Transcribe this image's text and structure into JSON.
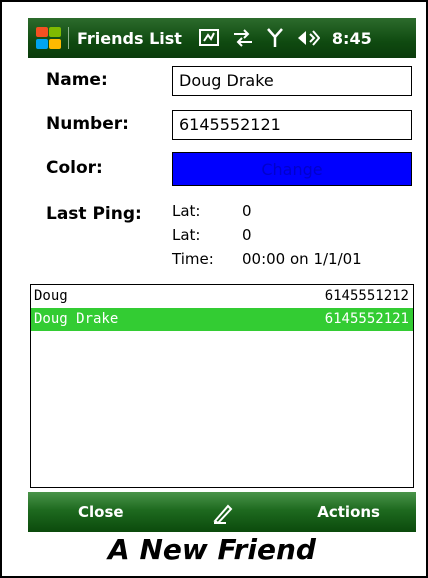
{
  "titlebar": {
    "title": "Friends List",
    "clock": "8:45",
    "icons": [
      "windows-start-icon",
      "sync-icon",
      "data-arrows-icon",
      "signal-icon",
      "volume-icon"
    ]
  },
  "form": {
    "name_label": "Name:",
    "name_value": "Doug Drake",
    "number_label": "Number:",
    "number_value": "6145552121",
    "color_label": "Color:",
    "color_button_label": "Change",
    "color_value": "#0000ff",
    "last_ping_label": "Last Ping:",
    "ping": [
      {
        "key": "Lat:",
        "value": "0"
      },
      {
        "key": "Lat:",
        "value": "0"
      },
      {
        "key": "Time:",
        "value": "00:00 on 1/1/01"
      }
    ]
  },
  "friends": [
    {
      "name": "Doug",
      "number": "6145551212",
      "selected": false
    },
    {
      "name": "Doug Drake",
      "number": "6145552121",
      "selected": true
    }
  ],
  "softkeys": {
    "left": "Close",
    "right": "Actions"
  },
  "caption": "A New Friend",
  "colors": {
    "title_bar": "#0f4a10",
    "selection": "#33cc33",
    "color_swatch": "#0000ff"
  }
}
